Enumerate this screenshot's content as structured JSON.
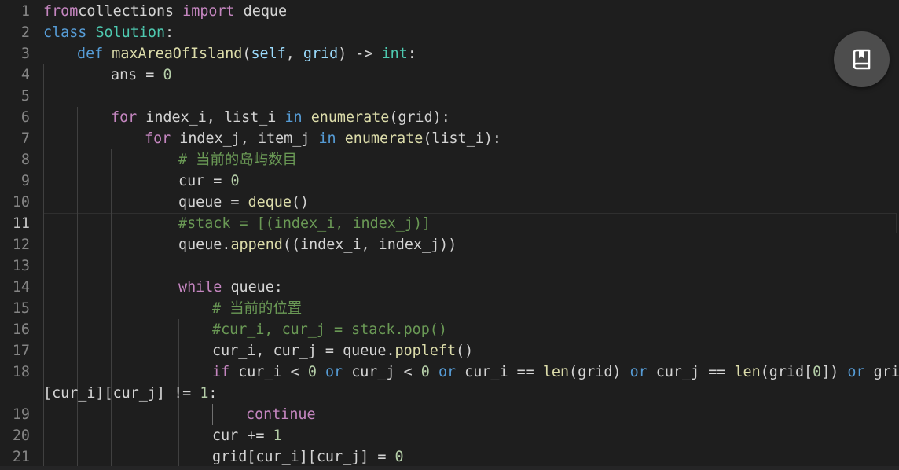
{
  "editor": {
    "active_line": 11,
    "lines": [
      {
        "n": "1",
        "tokens": [
          [
            "kw",
            "from"
          ],
          [
            "",
            "collections "
          ],
          [
            "kw",
            "import"
          ],
          [
            "",
            " deque"
          ]
        ]
      },
      {
        "n": "2",
        "tokens": [
          [
            "kw2",
            "class"
          ],
          [
            "",
            " "
          ],
          [
            "cls",
            "Solution"
          ],
          [
            "",
            ":"
          ]
        ]
      },
      {
        "n": "3",
        "tokens": [
          [
            "",
            ""
          ],
          [
            "kw2",
            "def"
          ],
          [
            "",
            " "
          ],
          [
            "fn",
            "maxAreaOfIsland"
          ],
          [
            "",
            "("
          ],
          [
            "param",
            "self"
          ],
          [
            "",
            ", "
          ],
          [
            "param",
            "grid"
          ],
          [
            "",
            ") -> "
          ],
          [
            "cls",
            "int"
          ],
          [
            "",
            ":"
          ]
        ]
      },
      {
        "n": "4",
        "tokens": [
          [
            "",
            "ans = "
          ],
          [
            "num",
            "0"
          ]
        ]
      },
      {
        "n": "5",
        "tokens": []
      },
      {
        "n": "6",
        "tokens": [
          [
            "kw",
            "for"
          ],
          [
            "",
            " index_i, list_i "
          ],
          [
            "kw2",
            "in"
          ],
          [
            "",
            " "
          ],
          [
            "fn",
            "enumerate"
          ],
          [
            "",
            "(grid):"
          ]
        ]
      },
      {
        "n": "7",
        "tokens": [
          [
            "kw",
            "for"
          ],
          [
            "",
            " index_j, item_j "
          ],
          [
            "kw2",
            "in"
          ],
          [
            "",
            " "
          ],
          [
            "fn",
            "enumerate"
          ],
          [
            "",
            "(list_i):"
          ]
        ]
      },
      {
        "n": "8",
        "tokens": [
          [
            "cmt",
            "# 当前的岛屿数目"
          ]
        ]
      },
      {
        "n": "9",
        "tokens": [
          [
            "",
            "cur = "
          ],
          [
            "num",
            "0"
          ]
        ]
      },
      {
        "n": "10",
        "tokens": [
          [
            "",
            "queue = "
          ],
          [
            "fn",
            "deque"
          ],
          [
            "",
            "()"
          ]
        ]
      },
      {
        "n": "11",
        "tokens": [
          [
            "cmt",
            "#stack = [(index_i, index_j)]"
          ]
        ]
      },
      {
        "n": "12",
        "tokens": [
          [
            "",
            "queue."
          ],
          [
            "fn",
            "append"
          ],
          [
            "",
            "((index_i, index_j))"
          ]
        ]
      },
      {
        "n": "13",
        "tokens": []
      },
      {
        "n": "14",
        "tokens": [
          [
            "kw",
            "while"
          ],
          [
            "",
            " queue:"
          ]
        ]
      },
      {
        "n": "15",
        "tokens": [
          [
            "cmt",
            "# 当前的位置"
          ]
        ]
      },
      {
        "n": "16",
        "tokens": [
          [
            "cmt",
            "#cur_i, cur_j = stack.pop()"
          ]
        ]
      },
      {
        "n": "17",
        "tokens": [
          [
            "",
            "cur_i, cur_j = queue."
          ],
          [
            "fn",
            "popleft"
          ],
          [
            "",
            "()"
          ]
        ]
      },
      {
        "n": "18",
        "tokens": [
          [
            "kw",
            "if"
          ],
          [
            "",
            " cur_i < "
          ],
          [
            "num",
            "0"
          ],
          [
            "",
            " "
          ],
          [
            "kw2",
            "or"
          ],
          [
            "",
            " cur_j < "
          ],
          [
            "num",
            "0"
          ],
          [
            "",
            " "
          ],
          [
            "kw2",
            "or"
          ],
          [
            "",
            " cur_i == "
          ],
          [
            "fn",
            "len"
          ],
          [
            "",
            "(grid) "
          ],
          [
            "kw2",
            "or"
          ],
          [
            "",
            " cur_j == "
          ],
          [
            "fn",
            "len"
          ],
          [
            "",
            "(grid["
          ],
          [
            "num",
            "0"
          ],
          [
            "",
            "]) "
          ],
          [
            "kw2",
            "or"
          ],
          [
            "",
            " grid"
          ]
        ]
      },
      {
        "n": "",
        "tokens": [
          [
            "",
            "[cur_i][cur_j] != "
          ],
          [
            "num",
            "1"
          ],
          [
            "",
            ":"
          ]
        ]
      },
      {
        "n": "19",
        "tokens": [
          [
            "kw",
            "continue"
          ]
        ]
      },
      {
        "n": "20",
        "tokens": [
          [
            "",
            "cur += "
          ],
          [
            "num",
            "1"
          ]
        ]
      },
      {
        "n": "21",
        "tokens": [
          [
            "",
            "grid[cur_i][cur_j] = "
          ],
          [
            "num",
            "0"
          ]
        ]
      }
    ]
  },
  "fab": {
    "icon": "bookmark-book-icon"
  }
}
